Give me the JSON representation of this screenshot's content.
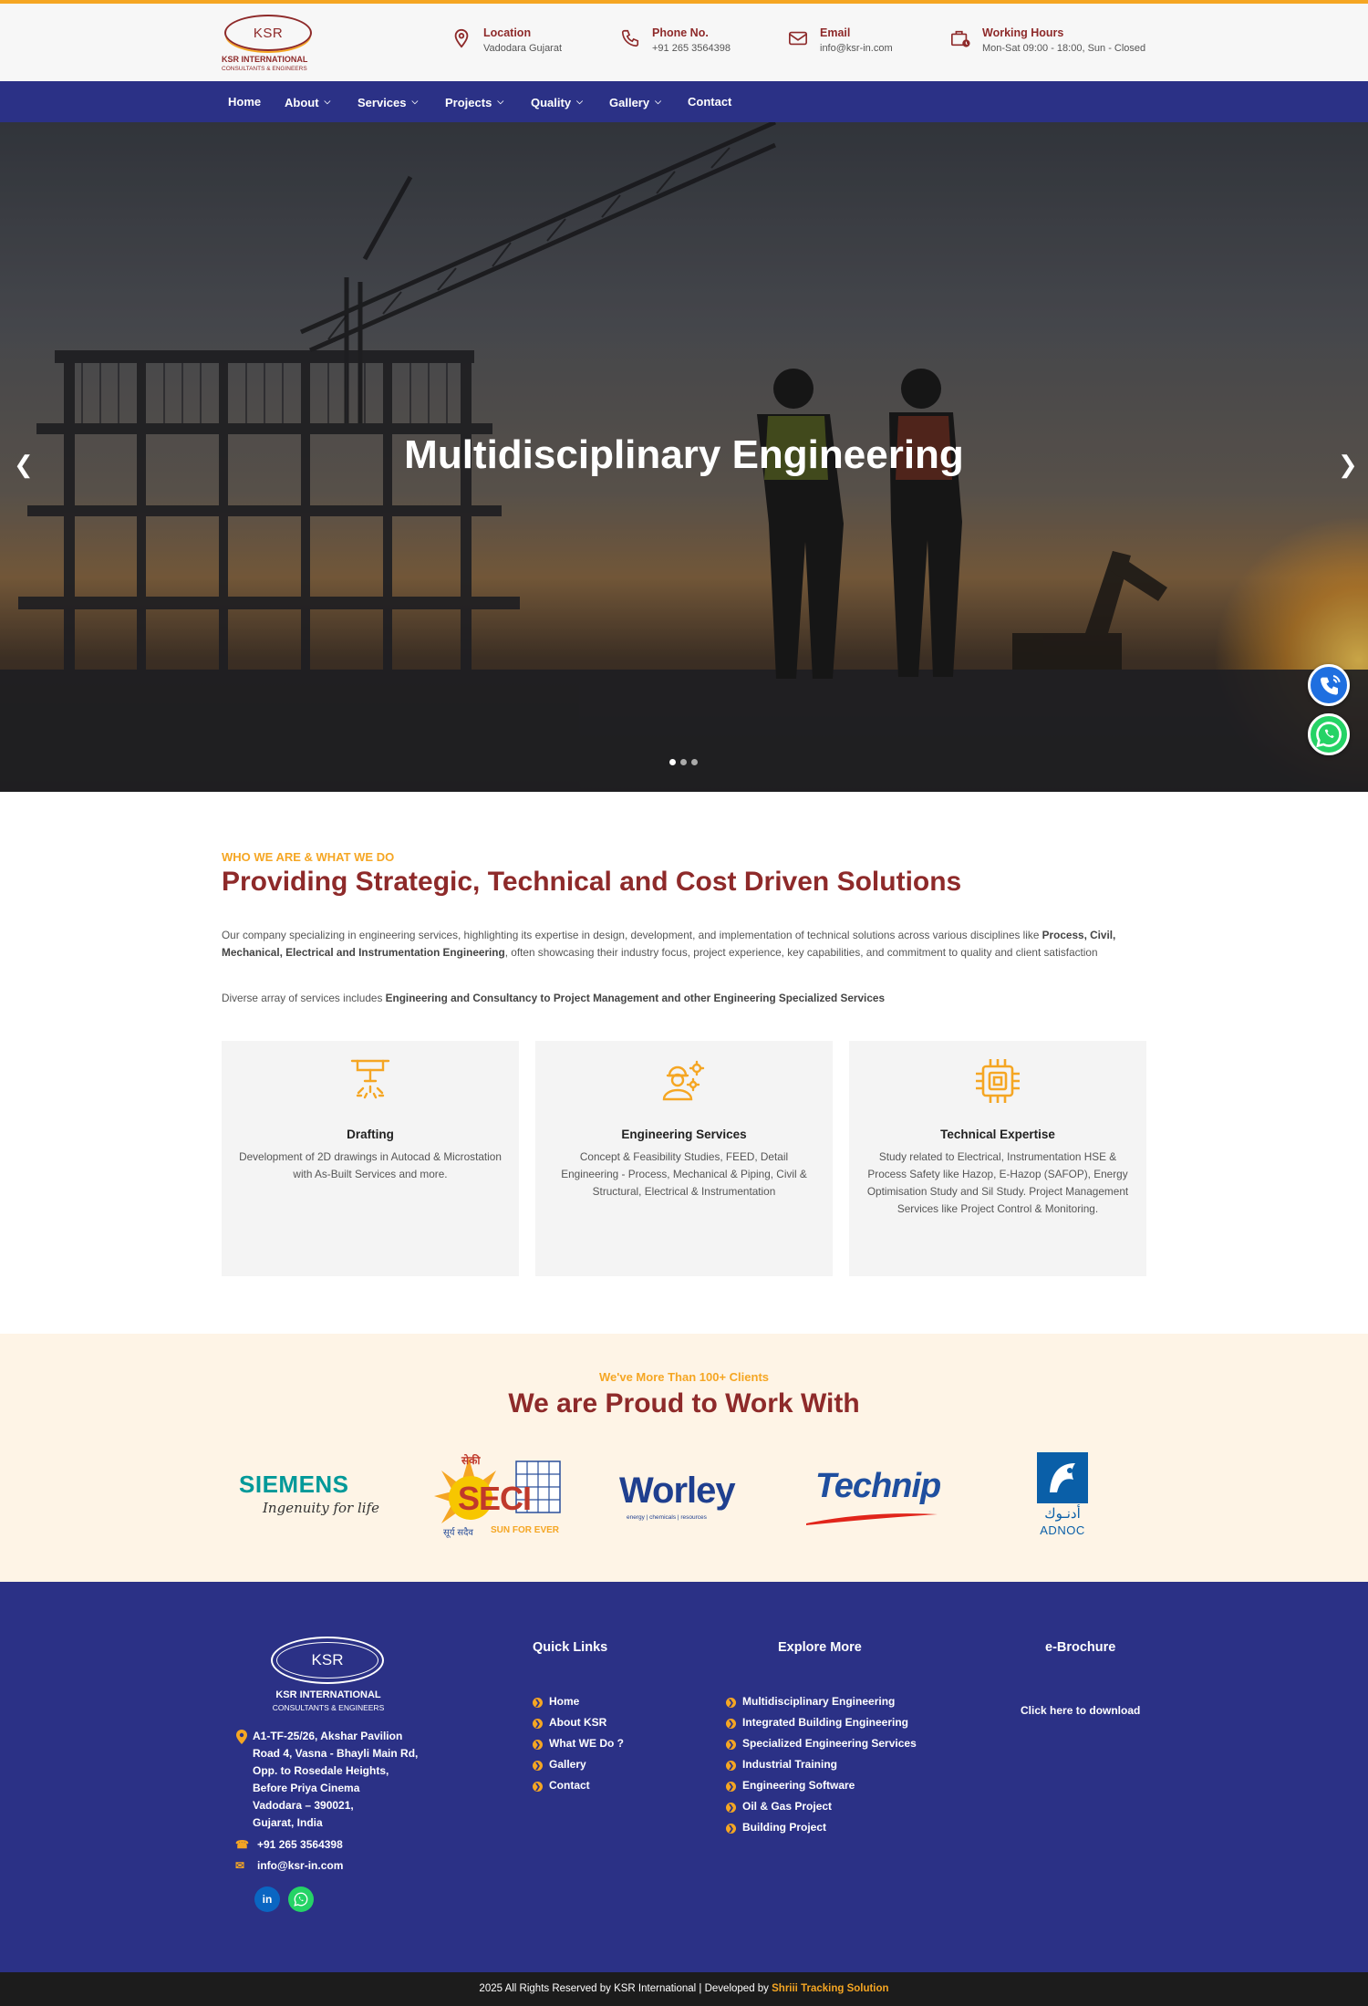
{
  "header": {
    "logo": {
      "mark": "KSR",
      "name": "KSR INTERNATIONAL",
      "tagline": "CONSULTANTS & ENGINEERS"
    },
    "info": [
      {
        "icon": "location-pin-icon",
        "title": "Location",
        "value": "Vadodara Gujarat"
      },
      {
        "icon": "phone-icon",
        "title": "Phone No.",
        "value": "+91 265 3564398"
      },
      {
        "icon": "mail-icon",
        "title": "Email",
        "value": "info@ksr-in.com"
      },
      {
        "icon": "briefcase-clock-icon",
        "title": "Working Hours",
        "value": "Mon-Sat 09:00 - 18:00, Sun - Closed"
      }
    ]
  },
  "nav": [
    {
      "label": "Home",
      "dropdown": false
    },
    {
      "label": "About",
      "dropdown": true
    },
    {
      "label": "Services",
      "dropdown": true
    },
    {
      "label": "Projects",
      "dropdown": true
    },
    {
      "label": "Quality",
      "dropdown": true
    },
    {
      "label": "Gallery",
      "dropdown": true
    },
    {
      "label": "Contact",
      "dropdown": false
    }
  ],
  "hero": {
    "title": "Multidisciplinary Engineering",
    "prev": "❮",
    "next": "❯",
    "slides": 3,
    "active_slide": 1
  },
  "about": {
    "eyebrow": "WHO WE ARE & WHAT WE DO",
    "heading": "Providing Strategic, Technical and Cost Driven Solutions",
    "p1_start": "Our company specializing in engineering services, highlighting its expertise in design, development, and implementation of technical solutions across various disciplines like ",
    "p1_bold": "Process, Civil, Mechanical, Electrical and Instrumentation Engineering",
    "p1_end": ", often showcasing their industry focus, project experience, key capabilities, and commitment to quality and client satisfaction",
    "p2_start": "Diverse array of services includes ",
    "p2_bold": "Engineering and Consultancy to Project Management and other Engineering Specialized Services"
  },
  "cards": [
    {
      "icon": "drafting-lamp-icon",
      "title": "Drafting",
      "desc": "Development of 2D drawings in Autocad & Microstation with As-Built Services and more."
    },
    {
      "icon": "engineer-gears-icon",
      "title": "Engineering Services",
      "desc": "Concept & Feasibility Studies, FEED, Detail Engineering - Process, Mechanical & Piping, Civil & Structural, Electrical & Instrumentation"
    },
    {
      "icon": "chip-icon",
      "title": "Technical Expertise",
      "desc": "Study related to Electrical, Instrumentation HSE & Process Safety like Hazop, E-Hazop (SAFOP), Energy Optimisation Study and Sil Study. Project Management Services like Project Control & Monitoring."
    }
  ],
  "clients": {
    "sub": "We've More Than 100+ Clients",
    "title": "We are Proud to Work With",
    "siemens": {
      "name": "SIEMENS",
      "tagline": "Ingenuity for life"
    },
    "seci": {
      "hindi": "सेकी",
      "name": "SECI",
      "hindi2": "सूर्य सदैव",
      "tagline": "SUN FOR EVER"
    },
    "worley": {
      "name": "Worley",
      "tagline": "energy | chemicals | resources"
    },
    "technip": {
      "name": "Technip"
    },
    "adnoc": {
      "arabic": "أدنـوك",
      "name": "ADNOC"
    }
  },
  "footer": {
    "logo": {
      "mark": "KSR",
      "name": "KSR INTERNATIONAL",
      "tagline": "CONSULTANTS & ENGINEERS"
    },
    "address": [
      "A1-TF-25/26, Akshar Pavilion",
      "Road 4, Vasna - Bhayli Main Rd,",
      "Opp. to Rosedale Heights,",
      "Before Priya Cinema",
      "Vadodara – 390021,",
      "Gujarat, India"
    ],
    "phone": "+91 265 3564398",
    "email": "info@ksr-in.com",
    "social": [
      {
        "label": "in",
        "color": "#0a66c2"
      },
      {
        "label": "wa",
        "color": "#25d366"
      }
    ],
    "quick_links_title": "Quick Links",
    "quick_links": [
      "Home",
      "About KSR",
      "What WE Do ?",
      "Gallery",
      "Contact"
    ],
    "explore_title": "Explore More",
    "explore": [
      "Multidisciplinary Engineering",
      "Integrated Building Engineering",
      "Specialized Engineering Services",
      "Industrial Training",
      "Engineering Software",
      "Oil & Gas Project",
      "Building Project"
    ],
    "brochure_title": "e-Brochure",
    "brochure_link": "Click here to download"
  },
  "copyright": {
    "text": "2025 All Rights Reserved by KSR International | Developed by ",
    "developer": "Shriii Tracking Solution"
  },
  "colors": {
    "brand_maroon": "#8e2a2a",
    "accent_orange": "#f5a623",
    "nav_blue": "#2b3186"
  }
}
